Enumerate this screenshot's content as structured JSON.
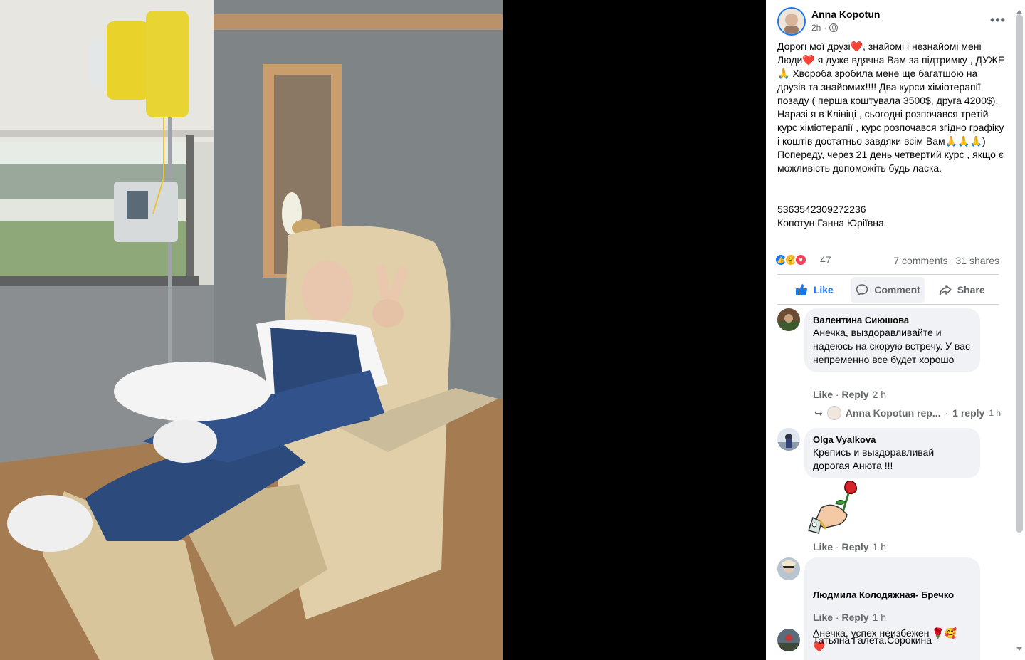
{
  "post": {
    "author": "Anna Kopotun",
    "time": "2h",
    "privacy_icon": "globe-icon",
    "text": "Дорогі мої друзі❤️, знайомі і незнайомі мені Люди❤️ я дуже вдячна Вам за підтримку , ДУЖЕ🙏 Хвороба зробила мене ще багатшою на друзів та знайомих!!!! Два курси хіміотерапії позаду ( перша коштувала 3500$, друга 4200$). Наразі я в Клініці , сьогодні розпочався третій курс хіміотерапії , курс розпочався згідно графіку і коштів достатньо завдяки всім Вам🙏🙏🙏)\nПопереду, через 21 день четвертий курс , якщо є можливість допоможіть будь ласка.",
    "card_number": "5363542309272236",
    "card_name": "Копотун Ганна Юріївна",
    "more_icon": "•••"
  },
  "stats": {
    "reaction_count": "47",
    "comments": "7 comments",
    "shares": "31 shares",
    "reaction_icons": [
      "like-icon",
      "care-icon",
      "love-icon"
    ]
  },
  "actions": {
    "like": "Like",
    "comment": "Comment",
    "share": "Share"
  },
  "comments": [
    {
      "name": "Валентина Сиюшова",
      "text": "Анечка, выздоравливайте и надеюсь на скорую встречу. У вас непременно все будет хорошо",
      "like": "Like",
      "reply": "Reply",
      "time": "2 h",
      "reply_preview": {
        "author": "Anna Kopotun rep...",
        "count": "1 reply",
        "time": "1 h"
      }
    },
    {
      "name": "Olga Vyalkova",
      "text": "Крепись и выздоравливай дорогая Анюта !!!",
      "like": "Like",
      "reply": "Reply",
      "time": "1 h",
      "sticker": "rose-hand-sticker"
    },
    {
      "name": "Людмила Колодяжная- Бречко",
      "text": "Анечка, успех неизбежен 🌹🥰\n❤️",
      "like": "Like",
      "reply": "Reply",
      "time": "1 h"
    },
    {
      "name": "Татьяна Галета.Сорокина"
    }
  ],
  "colors": {
    "accent": "#1877f2",
    "bubble": "#f0f2f5",
    "secondary_text": "#65676b",
    "love": "#f33e58",
    "care": "#f7b125"
  }
}
